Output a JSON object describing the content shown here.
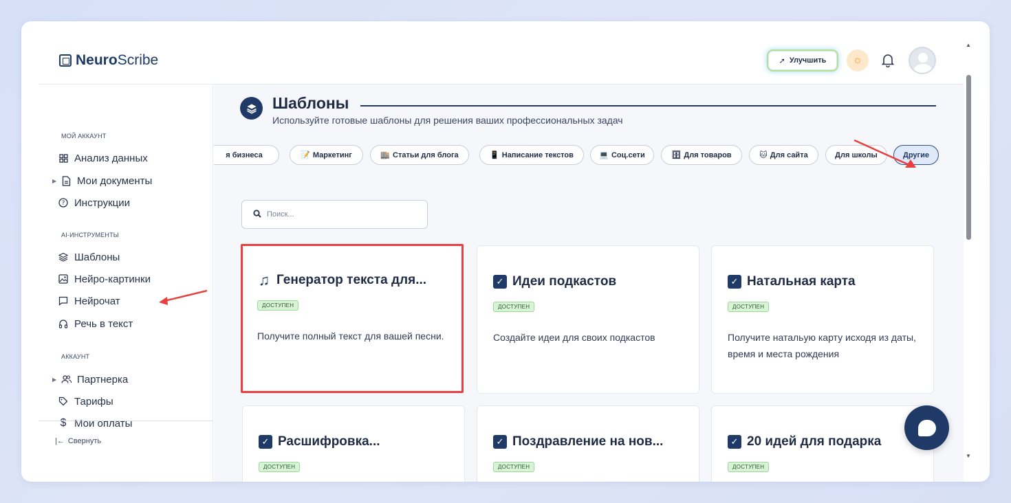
{
  "header": {
    "logo_bold": "Neuro",
    "logo_rest": "Scribe",
    "upgrade_label": "Улучшить"
  },
  "sidebar": {
    "sections": [
      {
        "title": "МОЙ АККАУНТ"
      },
      {
        "title": "AI-ИНСТРУМЕНТЫ"
      },
      {
        "title": "АККАУНТ"
      }
    ],
    "items": [
      {
        "label": "Анализ данных",
        "icon": "grid-icon"
      },
      {
        "label": "Мои документы",
        "icon": "document-icon",
        "expandable": true
      },
      {
        "label": "Инструкции",
        "icon": "help-circle-icon"
      },
      {
        "label": "Шаблоны",
        "icon": "layers-icon",
        "active": true
      },
      {
        "label": "Нейро-картинки",
        "icon": "image-icon"
      },
      {
        "label": "Нейрочат",
        "icon": "chat-icon"
      },
      {
        "label": "Речь в текст",
        "icon": "headphones-icon"
      },
      {
        "label": "Партнерка",
        "icon": "users-icon",
        "expandable": true
      },
      {
        "label": "Тарифы",
        "icon": "tag-icon"
      },
      {
        "label": "Мои оплаты",
        "icon": "dollar-icon"
      }
    ],
    "collapse_label": "Свернуть"
  },
  "main": {
    "title": "Шаблоны",
    "subtitle": "Используйте готовые шаблоны для решения ваших профессиональных задач",
    "chips": [
      {
        "label": "я бизнеса",
        "emoji": ""
      },
      {
        "label": "Маркетинг",
        "emoji": "📝"
      },
      {
        "label": "Статьи для блога",
        "emoji": "🏬"
      },
      {
        "label": "Написание текстов",
        "emoji": "📱"
      },
      {
        "label": "Соц.сети",
        "emoji": "💻"
      },
      {
        "label": "Для товаров",
        "emoji": "🗄"
      },
      {
        "label": "Для сайта",
        "emoji": "🐱"
      },
      {
        "label": "Для школы",
        "emoji": ""
      },
      {
        "label": "Другие",
        "emoji": "",
        "active": true
      }
    ],
    "search_placeholder": "Поиск...",
    "cards": [
      {
        "title": "Генератор текста для...",
        "icon": "music-note-icon",
        "badge": "ДОСТУПЕН",
        "desc": "Получите полный текст для вашей песни.",
        "highlighted": true
      },
      {
        "title": "Идеи подкастов",
        "icon": "checkbox-icon",
        "badge": "ДОСТУПЕН",
        "desc": "Создайте идеи для своих подкастов"
      },
      {
        "title": "Натальная карта",
        "icon": "checkbox-icon",
        "badge": "ДОСТУПЕН",
        "desc": "Получите натальую карту исходя из даты, время и места рождения"
      },
      {
        "title": "Расшифровка...",
        "icon": "checkbox-icon",
        "badge": "ДОСТУПЕН",
        "desc": ""
      },
      {
        "title": "Поздравление на нов...",
        "icon": "checkbox-icon",
        "badge": "ДОСТУПЕН",
        "desc": ""
      },
      {
        "title": "20 идей для подарка",
        "icon": "checkbox-icon",
        "badge": "ДОСТУПЕН",
        "desc": ""
      }
    ]
  },
  "colors": {
    "accent": "#1f3a66",
    "badge_bg": "#d8f3d6",
    "highlight": "#e84040",
    "annotation_arrow": "#e84040"
  }
}
